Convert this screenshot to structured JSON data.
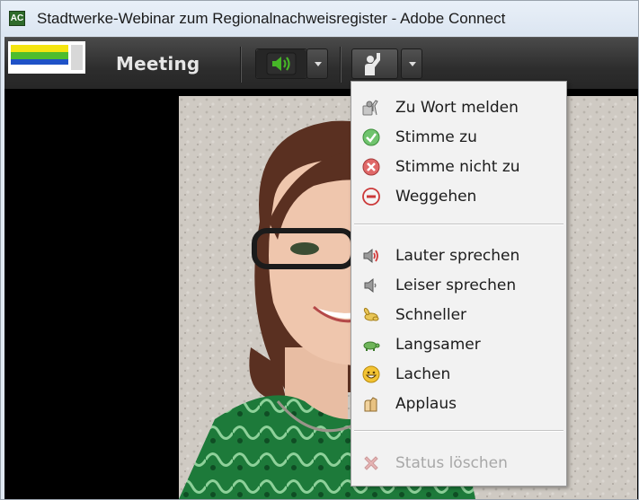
{
  "window": {
    "title": "Stadtwerke-Webinar zum Regionalnachweisregister - Adobe Connect",
    "app_icon": "adobe-connect-icon"
  },
  "toolbar": {
    "meeting_label": "Meeting",
    "audio_button_icon": "speaker-icon",
    "audio_button_active_color": "#46b527",
    "status_button_icon": "raise-hand-icon"
  },
  "status_menu": {
    "groups": [
      [
        {
          "label": "Zu Wort melden",
          "icon": "raise-hand-icon"
        },
        {
          "label": "Stimme zu",
          "icon": "check-circle-icon"
        },
        {
          "label": "Stimme nicht zu",
          "icon": "x-circle-icon"
        },
        {
          "label": "Weggehen",
          "icon": "minus-circle-icon"
        }
      ],
      [
        {
          "label": "Lauter sprechen",
          "icon": "speaker-loud-icon"
        },
        {
          "label": "Leiser sprechen",
          "icon": "speaker-quiet-icon"
        },
        {
          "label": "Schneller",
          "icon": "rabbit-icon"
        },
        {
          "label": "Langsamer",
          "icon": "turtle-icon"
        },
        {
          "label": "Lachen",
          "icon": "smiley-icon"
        },
        {
          "label": "Applaus",
          "icon": "clapping-icon"
        }
      ],
      [
        {
          "label": "Status löschen",
          "icon": "clear-status-icon",
          "disabled": true
        }
      ]
    ]
  },
  "colors": {
    "toolbar_bg": "#2d2d2d",
    "menu_bg": "#f2f2f2",
    "check_green": "#5cb85c",
    "error_red": "#d9534f"
  }
}
